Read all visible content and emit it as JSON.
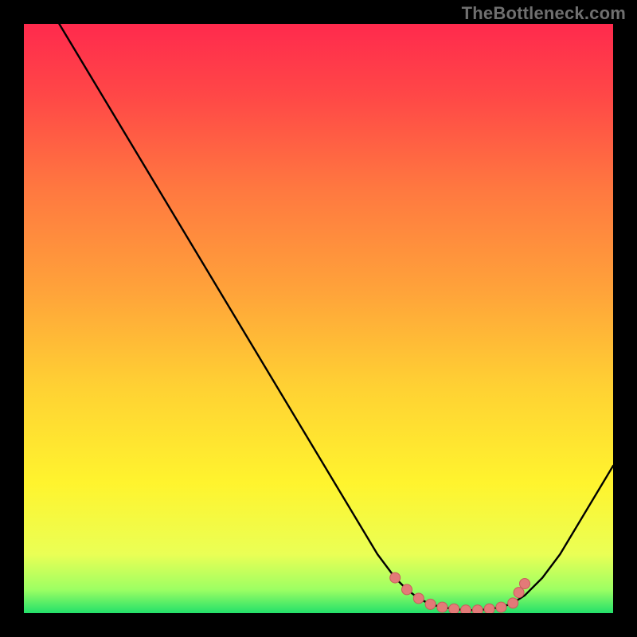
{
  "watermark": "TheBottleneck.com",
  "colors": {
    "page_bg": "#000000",
    "curve": "#000000",
    "marker_fill": "#e37a78",
    "marker_stroke": "#c95d5b",
    "gradient_stops": [
      {
        "offset": "0%",
        "color": "#ff2a4d"
      },
      {
        "offset": "12%",
        "color": "#ff4747"
      },
      {
        "offset": "28%",
        "color": "#ff7840"
      },
      {
        "offset": "45%",
        "color": "#ffa23a"
      },
      {
        "offset": "62%",
        "color": "#ffd233"
      },
      {
        "offset": "78%",
        "color": "#fff42e"
      },
      {
        "offset": "90%",
        "color": "#eaff55"
      },
      {
        "offset": "96%",
        "color": "#9dff63"
      },
      {
        "offset": "100%",
        "color": "#23e06a"
      }
    ]
  },
  "chart_data": {
    "type": "line",
    "title": "",
    "xlabel": "",
    "ylabel": "",
    "xlim": [
      0,
      100
    ],
    "ylim": [
      0,
      100
    ],
    "x": [
      0,
      3,
      6,
      9,
      12,
      15,
      18,
      21,
      24,
      27,
      30,
      33,
      36,
      39,
      42,
      45,
      48,
      51,
      54,
      57,
      60,
      63,
      65,
      67,
      69,
      71,
      73,
      75,
      77,
      79,
      81,
      83,
      85,
      88,
      91,
      94,
      97,
      100
    ],
    "values": [
      138,
      106,
      100,
      95,
      90,
      85,
      80,
      75,
      70,
      65,
      60,
      55,
      50,
      45,
      40,
      35,
      30,
      25,
      20,
      15,
      10,
      6,
      4,
      2.5,
      1.5,
      1,
      0.7,
      0.5,
      0.5,
      0.7,
      1,
      1.7,
      3,
      6,
      10,
      15,
      20,
      25
    ],
    "markers": [
      {
        "x": 63,
        "y": 6
      },
      {
        "x": 65,
        "y": 4
      },
      {
        "x": 67,
        "y": 2.5
      },
      {
        "x": 69,
        "y": 1.5
      },
      {
        "x": 71,
        "y": 1
      },
      {
        "x": 73,
        "y": 0.7
      },
      {
        "x": 75,
        "y": 0.5
      },
      {
        "x": 77,
        "y": 0.5
      },
      {
        "x": 79,
        "y": 0.7
      },
      {
        "x": 81,
        "y": 1
      },
      {
        "x": 83,
        "y": 1.7
      },
      {
        "x": 84,
        "y": 3.5
      },
      {
        "x": 85,
        "y": 5
      }
    ]
  }
}
